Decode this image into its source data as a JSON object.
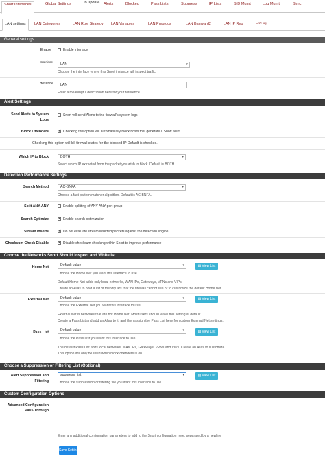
{
  "top_tabs": [
    {
      "label": "Snort Interfaces",
      "active": true
    },
    {
      "label": "Global Settings"
    },
    {
      "label": "to update"
    },
    {
      "label": "Alerts"
    },
    {
      "label": "Blocked"
    },
    {
      "label": "Pass Lists"
    },
    {
      "label": "Suppress"
    },
    {
      "label": "IP Lists"
    },
    {
      "label": "SID Mgmt"
    },
    {
      "label": "Log Mgmt"
    },
    {
      "label": "Sync"
    }
  ],
  "sub_tabs": [
    {
      "label": "LAN settings",
      "active": true
    },
    {
      "label": "LAN Categories"
    },
    {
      "label": "LAN Rule Strategy"
    },
    {
      "label": "LAN Variables"
    },
    {
      "label": "LAN Preprocs"
    },
    {
      "label": "LAN Barnyard2"
    },
    {
      "label": "LAN IP Rep"
    },
    {
      "label": "LAN log"
    }
  ],
  "general": {
    "title": "General settings",
    "enable_label": "Enable",
    "enable_text": "Enable interface",
    "interface_label": "Interface",
    "interface_value": "LAN",
    "interface_help": "Choose the interface where this Snort instance will inspect traffic.",
    "describe_label": "describe",
    "describe_value": "LAN",
    "describe_help": "Enter a meaningful description here for your reference."
  },
  "alert": {
    "title": "Alert Settings",
    "send_label": "Send Alerts to System Logs",
    "send_text": "Snort will send Alerts to the firewall's system logs",
    "block_label": "Block Offenders",
    "block_text": "Checking this option will automatically block hosts that generate a Snort alert",
    "kill_text": "Checking this option will kill firewall states for the blocked IP Default is checked.",
    "which_label": "Which IP to Block",
    "which_value": "BOTH",
    "which_help": "Select which IP extracted from the packet you wish to block. Default is BOTH."
  },
  "detection": {
    "title": "Detection Performance Settings",
    "search_label": "Search Method",
    "search_value": "AC-BNFA",
    "search_help": "Choose a fast pattern matcher algorithm. Default is AC-BNFA.",
    "split_label": "Split ANY-ANY",
    "split_text": "Enable splitting of ANY-ANY port group",
    "opt_label": "Search Optimize",
    "opt_text": "Enable search optimization",
    "stream_label": "Stream Inserts",
    "stream_text": "Do not evaluate stream inserted packets against the detection engine",
    "checksum_label": "Checksum Check Disable",
    "checksum_text": "Disable checksum checking within Snort to improve performance"
  },
  "networks": {
    "title": "Choose the Networks Snort Should Inspect and Whitelist",
    "view_list": "View List",
    "home_label": "Home Net",
    "home_value": "Default value",
    "home_help1": "Choose the Home Net you want this interface to use.",
    "home_help2": "Default Home Net adds only local networks, WAN IPs, Gateways, VPNs and VIPs.",
    "home_help3": "Create an Alias to hold a list of friendly IPs that the firewall cannot see or to customize the default Home Net.",
    "external_label": "External Net",
    "external_value": "Default value",
    "external_help1": "Choose the External Net you want this interface to use.",
    "external_help2": "External Net is networks that are not Home Net. Most users should leave this setting at default.",
    "external_help3": "Create a Pass List and add an Alias to it, and then assign the Pass List here for custom External Net settings.",
    "pass_label": "Pass List",
    "pass_value": "Default value",
    "pass_help1": "Choose the Pass List you want this interface to use.",
    "pass_help2": "The default Pass List adds local networks, WAN IPs, Gateways, VPNs and VIPs. Create an Alias to customize.",
    "pass_help3": "This option will only be used when block offenders is on."
  },
  "suppression": {
    "title": "Choose a Suppression or Filtering List (Optional)",
    "label": "Alert Suppression and Filtering",
    "value": "suppress_list",
    "view_list": "View List",
    "help": "Choose the suppression or filtering file you want this interface to use."
  },
  "custom": {
    "title": "Custom Configuration Options",
    "label": "Advanced Configuration Pass-Through",
    "help": "Enter any additional configuration parameters to add to the Snort configuration here, separated by a newline"
  },
  "save_label": "Save Settings"
}
